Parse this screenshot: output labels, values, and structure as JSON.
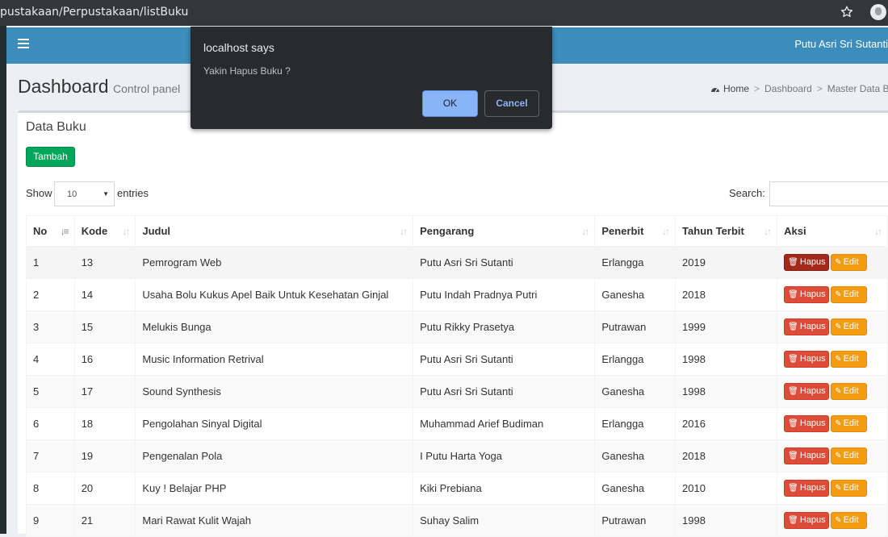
{
  "browser": {
    "url": "pustakaan/Perpustakaan/listBuku"
  },
  "topnav": {
    "user_name": "Putu Asri Sri Sutanti"
  },
  "header": {
    "title": "Dashboard",
    "subtitle": "Control panel",
    "breadcrumb": [
      "Home",
      "Dashboard",
      "Master Data Buku"
    ]
  },
  "box": {
    "title": "Data Buku",
    "add_label": "Tambah",
    "show_label": "Show",
    "entries_value": "10",
    "entries_label": "entries",
    "search_label": "Search:"
  },
  "table": {
    "columns": [
      "No",
      "Kode",
      "Judul",
      "Pengarang",
      "Penerbit",
      "Tahun Terbit",
      "Aksi"
    ],
    "hapus_label": "Hapus",
    "edit_label": "Edit",
    "rows": [
      {
        "no": "1",
        "kode": "13",
        "judul": "Pemrogram Web",
        "pengarang": "Putu Asri Sri Sutanti",
        "penerbit": "Erlangga",
        "tahun": "2019"
      },
      {
        "no": "2",
        "kode": "14",
        "judul": "Usaha Bolu Kukus Apel Baik Untuk Kesehatan Ginjal",
        "pengarang": "Putu Indah Pradnya Putri",
        "penerbit": "Ganesha",
        "tahun": "2018"
      },
      {
        "no": "3",
        "kode": "15",
        "judul": "Melukis Bunga",
        "pengarang": "Putu Rikky Prasetya",
        "penerbit": "Putrawan",
        "tahun": "1999"
      },
      {
        "no": "4",
        "kode": "16",
        "judul": "Music Information Retrival",
        "pengarang": "Putu Asri Sri Sutanti",
        "penerbit": "Erlangga",
        "tahun": "1998"
      },
      {
        "no": "5",
        "kode": "17",
        "judul": "Sound Synthesis",
        "pengarang": "Putu Asri Sri Sutanti",
        "penerbit": "Ganesha",
        "tahun": "1998"
      },
      {
        "no": "6",
        "kode": "18",
        "judul": "Pengolahan Sinyal Digital",
        "pengarang": "Muhammad Arief Budiman",
        "penerbit": "Erlangga",
        "tahun": "2016"
      },
      {
        "no": "7",
        "kode": "19",
        "judul": "Pengenalan Pola",
        "pengarang": "I Putu Harta Yoga",
        "penerbit": "Ganesha",
        "tahun": "2018"
      },
      {
        "no": "8",
        "kode": "20",
        "judul": "Kuy ! Belajar PHP",
        "pengarang": "Kiki Prebiana",
        "penerbit": "Ganesha",
        "tahun": "2010"
      },
      {
        "no": "9",
        "kode": "21",
        "judul": "Mari Rawat Kulit Wajah",
        "pengarang": "Suhay Salim",
        "penerbit": "Putrawan",
        "tahun": "1998"
      }
    ]
  },
  "dialog": {
    "title": "localhost says",
    "message": "Yakin Hapus Buku ?",
    "ok_label": "OK",
    "cancel_label": "Cancel"
  },
  "colors": {
    "nav": "#3c8dbc",
    "success": "#00a65a",
    "danger": "#dd4b39",
    "warning": "#f39c12",
    "dialog_bg": "#292a2d",
    "dialog_accent": "#8ab4f8"
  },
  "icons": {
    "browser": [
      "star-icon",
      "profile-icon"
    ],
    "nav": "menu-icon",
    "breadcrumb": "dashboard-icon",
    "table": [
      "sort-icon",
      "trash-icon",
      "pencil-icon"
    ]
  }
}
